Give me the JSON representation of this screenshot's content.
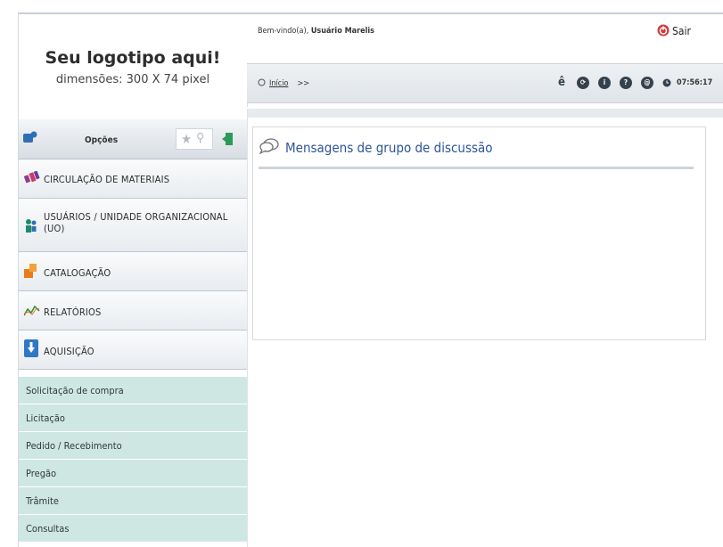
{
  "logo": {
    "title": "Seu logotipo aqui!",
    "subtitle": "dimensões: 300 X 74 pixel"
  },
  "header": {
    "welcome_prefix": "Bem-vindo(a),",
    "user_name": "Usuário Marelis",
    "logout_label": "Sair",
    "breadcrumb_home": "Início",
    "breadcrumb_sep": ">>",
    "clock": "07:56:17"
  },
  "sidebar": {
    "options_label": "Opções",
    "menu": [
      {
        "label": "CIRCULAÇÃO DE MATERIAIS",
        "icon": "circulation-icon"
      },
      {
        "label": "USUÁRIOS / UNIDADE ORGANIZACIONAL (UO)",
        "icon": "users-icon"
      },
      {
        "label": "CATALOGAÇÃO",
        "icon": "catalog-icon"
      },
      {
        "label": "RELATÓRIOS",
        "icon": "reports-icon"
      },
      {
        "label": "AQUISIÇÃO",
        "icon": "acquisition-icon"
      }
    ],
    "submenu": [
      "Solicitação de compra",
      "Licitação",
      "Pedido / Recebimento",
      "Pregão",
      "Trâmite",
      "Consultas"
    ]
  },
  "main": {
    "panel_title": "Mensagens de grupo de discussão"
  },
  "colors": {
    "accent": "#2e5597",
    "submenu_bg": "#cfe7e3",
    "logout_icon": "#d23b3b"
  }
}
